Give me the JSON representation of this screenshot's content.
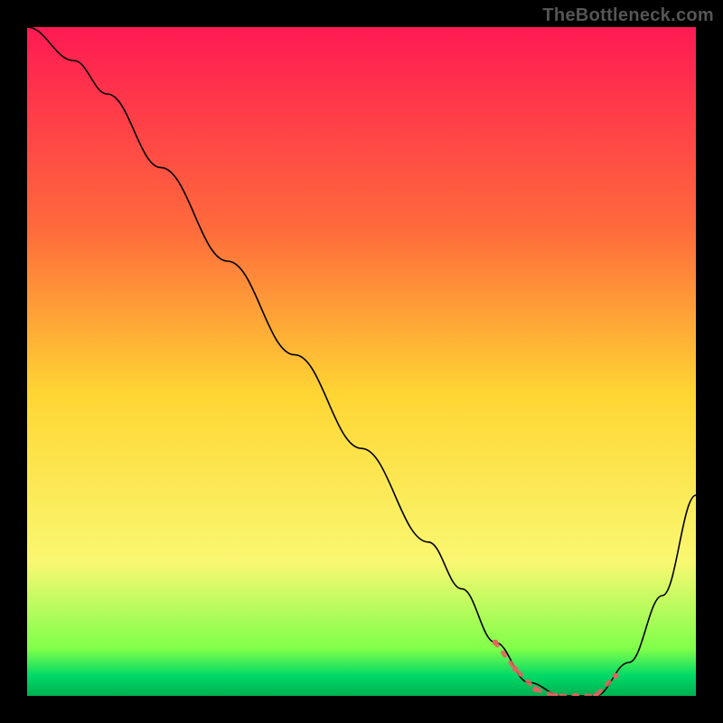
{
  "watermark": "TheBottleneck.com",
  "chart_data": {
    "type": "line",
    "title": "",
    "xlabel": "",
    "ylabel": "",
    "xlim": [
      0,
      100
    ],
    "ylim": [
      0,
      100
    ],
    "grid": false,
    "legend": false,
    "gradient_stops": [
      {
        "offset": 0.0,
        "color": "#ff1a52"
      },
      {
        "offset": 0.3,
        "color": "#ff6a3c"
      },
      {
        "offset": 0.55,
        "color": "#ffd633"
      },
      {
        "offset": 0.8,
        "color": "#f9f871"
      },
      {
        "offset": 0.93,
        "color": "#7fff4a"
      },
      {
        "offset": 0.97,
        "color": "#00d967"
      },
      {
        "offset": 1.0,
        "color": "#00b050"
      }
    ],
    "series": [
      {
        "name": "bottleneck-curve",
        "color": "#000000",
        "stroke_width": 1.6,
        "x": [
          0,
          7,
          12,
          20,
          30,
          40,
          50,
          60,
          65,
          70,
          75,
          80,
          85,
          90,
          95,
          100
        ],
        "values": [
          100,
          95,
          90,
          79,
          65,
          51,
          37,
          23,
          16,
          8,
          2,
          0,
          0,
          5,
          15,
          30
        ]
      },
      {
        "name": "sweet-spot-markers",
        "color": "#e86060",
        "points": [
          {
            "x": 70,
            "y": 8
          },
          {
            "x": 73,
            "y": 4
          },
          {
            "x": 76,
            "y": 1
          },
          {
            "x": 79,
            "y": 0
          },
          {
            "x": 82,
            "y": 0
          },
          {
            "x": 85,
            "y": 0
          },
          {
            "x": 88,
            "y": 3
          }
        ]
      }
    ]
  }
}
